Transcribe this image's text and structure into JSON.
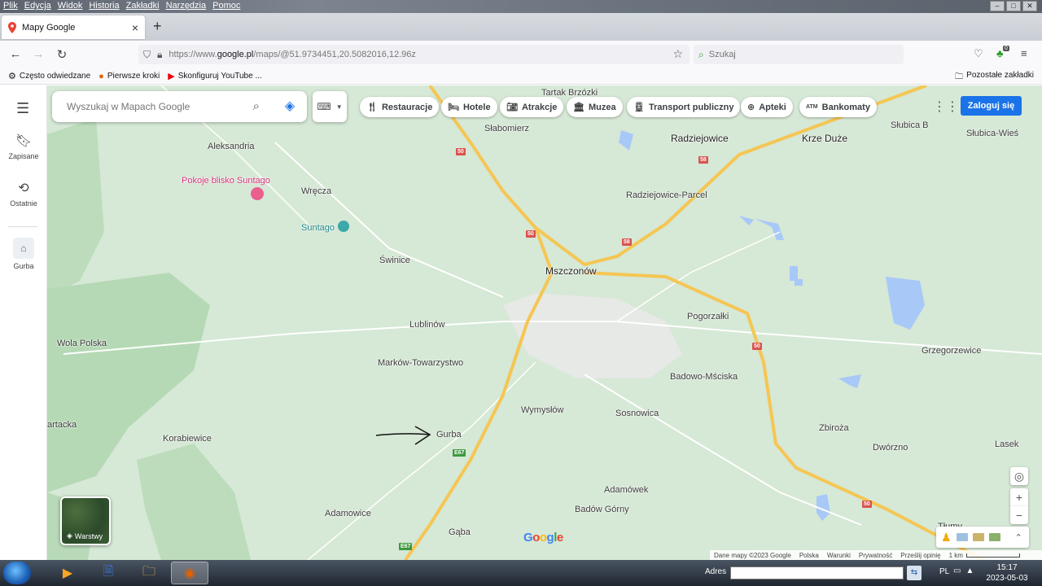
{
  "os_menu": {
    "items": [
      "Plik",
      "Edycja",
      "Widok",
      "Historia",
      "Zakładki",
      "Narzędzia",
      "Pomoc"
    ]
  },
  "browser": {
    "tab_title": "Mapy Google",
    "url_prefix": "https://www.",
    "url_host": "google.pl",
    "url_path": "/maps/@51.9734451,20.5082016,12.96z",
    "search_placeholder": "Szukaj",
    "extension_badge": "0",
    "bookmarks": [
      "Często odwiedzane",
      "Pierwsze kroki",
      "Skonfiguruj YouTube ..."
    ],
    "other_bookmarks": "Pozostałe zakładki"
  },
  "maps": {
    "sidebar": [
      {
        "label": "Zapisane",
        "icon": "bookmark-icon"
      },
      {
        "label": "Ostatnie",
        "icon": "history-icon"
      },
      {
        "label": "Gurba",
        "icon": "place-icon"
      }
    ],
    "search_placeholder": "Wyszukaj w Mapach Google",
    "chips": [
      "Restauracje",
      "Hotele",
      "Atrakcje",
      "Muzea",
      "Transport publiczny",
      "Apteki",
      "Bankomaty"
    ],
    "signin_label": "Zaloguj się",
    "layers_label": "Warstwy",
    "logo_text": "Google",
    "places": {
      "tartak": "Tartak Brzózki",
      "slabomierz": "Słabomierz",
      "radziejowice": "Radziejowice",
      "krze": "Krze Duże",
      "slubica_b": "Słubica B",
      "slubica_wies": "Słubica-Wieś",
      "aleksandria": "Aleksandria",
      "pokoje": "Pokoje blisko Suntago",
      "wrecza": "Wręcza",
      "radziejowice_parcel": "Radziejowice-Parcel",
      "suntago": "Suntago",
      "swinice": "Świnice",
      "mszczonow": "Mszczonów",
      "pogorzalki": "Pogorzałki",
      "lublinow": "Lublinów",
      "wola_polska": "Wola Polska",
      "grzegorzewice": "Grzegorzewice",
      "markow": "Marków-Towarzystwo",
      "badowo": "Badowo-Mściska",
      "wymyslow": "Wymysłów",
      "sosnowica": "Sosnowica",
      "artacka": "artacka",
      "gurba": "Gurba",
      "zbiroza": "Zbiroża",
      "dworzno": "Dwórzno",
      "lasek": "Lasek",
      "korabiewice": "Korabiewice",
      "adamowek": "Adamówek",
      "badow_gorny": "Badów Górny",
      "adamowice": "Adamowice",
      "gaba": "Gąba",
      "tlumy": "Tłumy"
    },
    "shields": {
      "s50a": "50",
      "s50b": "50",
      "s58a": "58",
      "s58b": "58",
      "s50c": "50",
      "s50d": "50",
      "e67a": "E67",
      "e67b": "E67"
    },
    "footer": [
      "Dane mapy ©2023 Google",
      "Polska",
      "Warunki",
      "Prywatność",
      "Prześlij opinię",
      "1 km"
    ]
  },
  "taskbar": {
    "addr_label": "Adres",
    "lang": "PL",
    "time": "15:17",
    "date": "2023-05-03"
  },
  "colors": {
    "accent": "#1a73e8",
    "map_bg": "#d6e8d6",
    "road": "#f5c653",
    "water": "#a8c8f8",
    "poi": "#d5337a"
  }
}
